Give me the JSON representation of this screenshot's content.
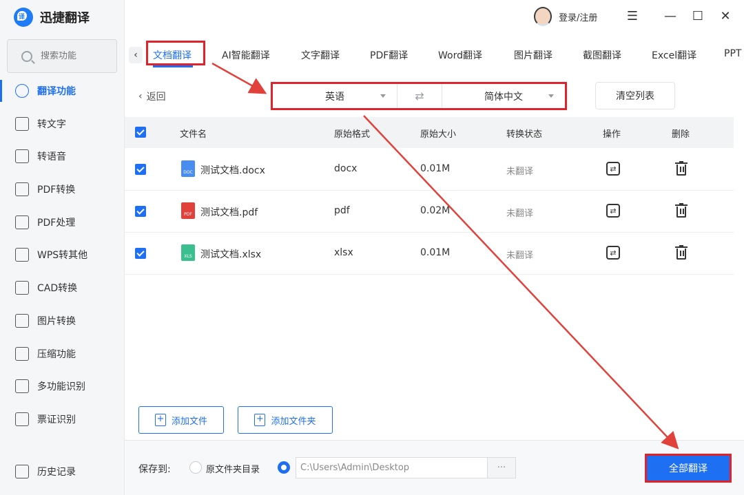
{
  "app": {
    "name": "迅捷翻译",
    "logo_text": "译",
    "login_label": "登录/注册"
  },
  "search": {
    "placeholder": "搜索功能"
  },
  "sidebar": {
    "items": [
      {
        "label": "翻译功能",
        "active": true
      },
      {
        "label": "转文字"
      },
      {
        "label": "转语音"
      },
      {
        "label": "PDF转换"
      },
      {
        "label": "PDF处理"
      },
      {
        "label": "WPS转其他"
      },
      {
        "label": "CAD转换"
      },
      {
        "label": "图片转换"
      },
      {
        "label": "压缩功能"
      },
      {
        "label": "多功能识别"
      },
      {
        "label": "票证识别"
      },
      {
        "label": "历史记录"
      }
    ]
  },
  "tabs": [
    "文档翻译",
    "AI智能翻译",
    "文字翻译",
    "PDF翻译",
    "Word翻译",
    "图片翻译",
    "截图翻译",
    "Excel翻译",
    "PPT"
  ],
  "toolbar": {
    "back_label": "返回",
    "source_lang": "英语",
    "target_lang": "简体中文",
    "clear_label": "清空列表"
  },
  "table": {
    "headers": [
      "文件名",
      "原始格式",
      "原始大小",
      "转换状态",
      "操作",
      "删除"
    ],
    "rows": [
      {
        "name": "测试文档.docx",
        "format": "docx",
        "size": "0.01M",
        "status": "未翻译",
        "icon": "DOC",
        "icon_color": "#4a8df0"
      },
      {
        "name": "测试文档.pdf",
        "format": "pdf",
        "size": "0.02M",
        "status": "未翻译",
        "icon": "PDF",
        "icon_color": "#e0413a"
      },
      {
        "name": "测试文档.xlsx",
        "format": "xlsx",
        "size": "0.01M",
        "status": "未翻译",
        "icon": "XLS",
        "icon_color": "#3cbf8f"
      }
    ]
  },
  "actions": {
    "add_file": "添加文件",
    "add_folder": "添加文件夹"
  },
  "footer": {
    "save_to_label": "保存到:",
    "original_dir_label": "原文件夹目录",
    "path_value": "C:\\Users\\Admin\\Desktop",
    "browse_label": "···",
    "translate_all_label": "全部翻译"
  },
  "colors": {
    "accent": "#1f6ff2",
    "highlight": "#e0222a"
  }
}
